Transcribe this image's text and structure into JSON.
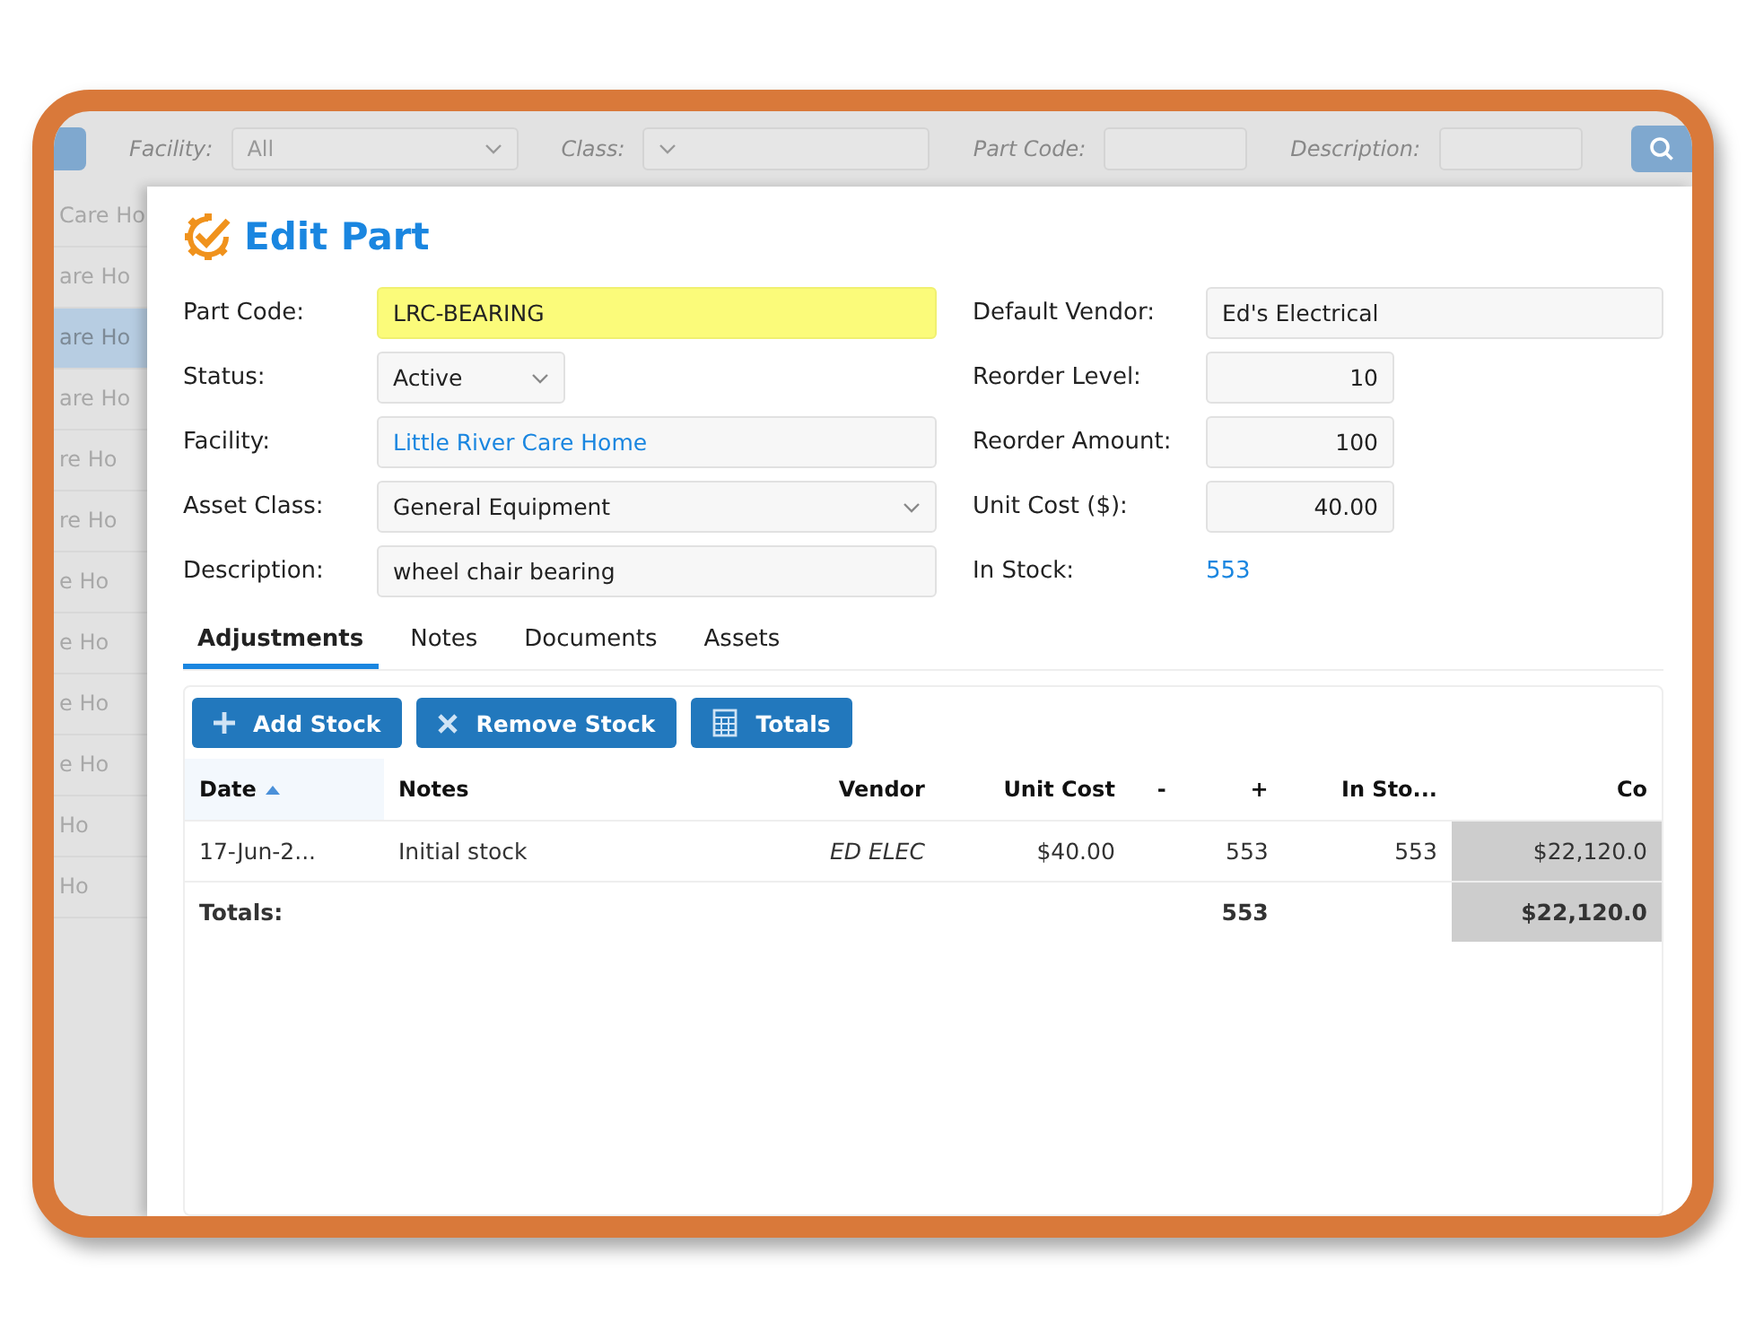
{
  "filter_bar": {
    "fields": [
      {
        "label": "Facility:",
        "value": "All",
        "kind": "select"
      },
      {
        "label": "Class:",
        "kind": "select"
      },
      {
        "label": "Part Code:",
        "kind": "text"
      },
      {
        "label": "Description:",
        "kind": "text"
      }
    ]
  },
  "list": {
    "items": [
      {
        "text": "Care Ho",
        "selected": false
      },
      {
        "text": "are Ho",
        "selected": false
      },
      {
        "text": "are Ho",
        "selected": true
      },
      {
        "text": "are Ho",
        "selected": false
      },
      {
        "text": "re Ho",
        "selected": false
      },
      {
        "text": "re Ho",
        "selected": false
      },
      {
        "text": "e Ho",
        "selected": false
      },
      {
        "text": "e Ho",
        "selected": false
      },
      {
        "text": "e Ho",
        "selected": false
      },
      {
        "text": "e Ho",
        "selected": false
      },
      {
        "text": "Ho",
        "selected": false
      },
      {
        "text": "Ho",
        "selected": false
      }
    ]
  },
  "dialog": {
    "title": "Edit Part",
    "left_fields": [
      {
        "label": "Part Code:",
        "value": "LRC-BEARING",
        "kind": "text",
        "highlighted": true,
        "compact": false
      },
      {
        "label": "Status:",
        "value": "Active",
        "kind": "select",
        "highlighted": false,
        "compact": true
      },
      {
        "label": "Facility:",
        "value": "Little River Care Home",
        "kind": "link",
        "highlighted": false,
        "compact": false
      },
      {
        "label": "Asset Class:",
        "value": "General Equipment",
        "kind": "select",
        "highlighted": false,
        "compact": false
      },
      {
        "label": "Description:",
        "value": "wheel chair bearing",
        "kind": "text",
        "highlighted": false,
        "compact": false
      }
    ],
    "right_fields": [
      {
        "label": "Default Vendor:",
        "value": "Ed's Electrical",
        "kind": "text"
      },
      {
        "label": "Reorder Level:",
        "value": "10",
        "kind": "number"
      },
      {
        "label": "Reorder Amount:",
        "value": "100",
        "kind": "number"
      },
      {
        "label": "Unit Cost ($):",
        "value": "40.00",
        "kind": "number"
      },
      {
        "label": "In Stock:",
        "value": "553",
        "kind": "link"
      }
    ],
    "tabs": [
      {
        "label": "Adjustments",
        "selected": true
      },
      {
        "label": "Notes",
        "selected": false
      },
      {
        "label": "Documents",
        "selected": false
      },
      {
        "label": "Assets",
        "selected": false
      }
    ],
    "buttons": [
      {
        "label": "Add Stock",
        "kind": "add"
      },
      {
        "label": "Remove Stock",
        "kind": "remove"
      },
      {
        "label": "Totals",
        "kind": "totals"
      }
    ],
    "table": {
      "columns": [
        {
          "label": "Date",
          "sorted": true
        },
        {
          "label": "Notes",
          "sorted": false
        },
        {
          "label": "Vendor",
          "sorted": false
        },
        {
          "label": "Unit Cost",
          "sorted": false
        },
        {
          "label": "-",
          "sorted": false
        },
        {
          "label": "+",
          "sorted": false
        },
        {
          "label": "In Sto...",
          "sorted": false
        },
        {
          "label": "Co",
          "sorted": false
        }
      ],
      "rows": [
        {
          "date": "17-Jun-2...",
          "notes": "Initial stock",
          "vendor": "ED ELEC",
          "unit_cost": "$40.00",
          "plus": "553",
          "in_stock": "553",
          "cost": "$22,120.0"
        }
      ],
      "totals": {
        "label": "Totals:",
        "plus": "553",
        "cost": "$22,120.0"
      }
    }
  }
}
